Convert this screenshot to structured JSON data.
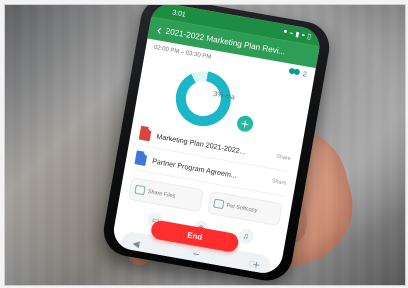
{
  "status": {
    "time": "3:01",
    "icons": [
      "alert-icon",
      "vibrate-icon",
      "signal-icon",
      "wifi-icon",
      "battery-icon"
    ]
  },
  "header": {
    "back_icon": "‹",
    "title": "2021-2022 Marketing Plan Revi..."
  },
  "session": {
    "time_range": "02:00 PM – 03:30 PM",
    "participant_count": "2"
  },
  "progress": {
    "label": "3% ma",
    "value": 0.9
  },
  "files": [
    {
      "name": "Marketing Plan 2021-2022...",
      "share": "Share"
    },
    {
      "name": "Partner Program Agreem...",
      "share": "Share"
    }
  ],
  "actions": [
    {
      "label": "Share Files"
    },
    {
      "label": "Pet Softcopy"
    }
  ],
  "controls": {
    "minus": "−",
    "plus": "+"
  },
  "end_label": "End",
  "nav": {
    "back": "‹",
    "home": "○",
    "recent": "□"
  },
  "colors": {
    "status_green": "#1c8d42",
    "header_green": "#2e9d55",
    "accent_teal": "#1bb7c9",
    "end_red": "#ff2d2d"
  }
}
